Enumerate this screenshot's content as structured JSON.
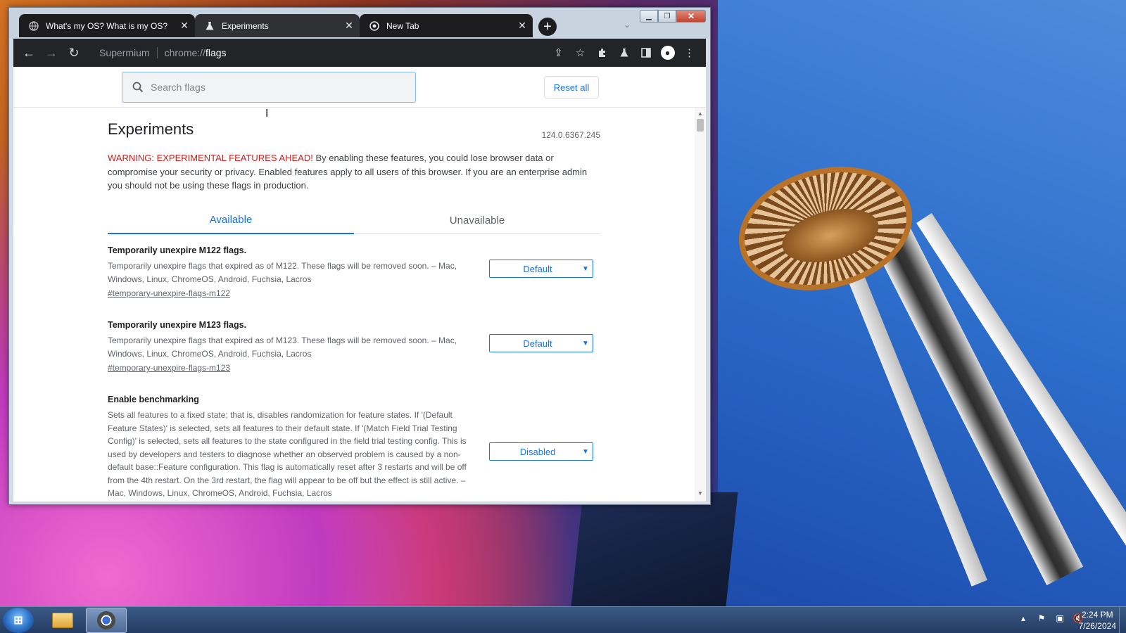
{
  "browser": {
    "tabs": [
      {
        "title": "What's my OS? What is my OS?",
        "icon": "globe-icon"
      },
      {
        "title": "Experiments",
        "icon": "flask-icon"
      },
      {
        "title": "New Tab",
        "icon": "chromium-icon"
      }
    ],
    "omnibox": {
      "host": "Supermium",
      "url_prefix": "chrome://",
      "url_path": "flags"
    }
  },
  "page": {
    "search_placeholder": "Search flags",
    "reset_label": "Reset all",
    "title": "Experiments",
    "version": "124.0.6367.245",
    "warning_lead": "WARNING: EXPERIMENTAL FEATURES AHEAD!",
    "warning_body": " By enabling these features, you could lose browser data or compromise your security or privacy. Enabled features apply to all users of this browser. If you are an enterprise admin you should not be using these flags in production.",
    "tabs": [
      {
        "label": "Available",
        "active": true
      },
      {
        "label": "Unavailable",
        "active": false
      }
    ],
    "flags": [
      {
        "name": "Temporarily unexpire M122 flags.",
        "description": "Temporarily unexpire flags that expired as of M122. These flags will be removed soon. – Mac, Windows, Linux, ChromeOS, Android, Fuchsia, Lacros",
        "link": "#temporary-unexpire-flags-m122",
        "value": "Default"
      },
      {
        "name": "Temporarily unexpire M123 flags.",
        "description": "Temporarily unexpire flags that expired as of M123. These flags will be removed soon. – Mac, Windows, Linux, ChromeOS, Android, Fuchsia, Lacros",
        "link": "#temporary-unexpire-flags-m123",
        "value": "Default"
      },
      {
        "name": "Enable benchmarking",
        "description": "Sets all features to a fixed state; that is, disables randomization for feature states. If '(Default Feature States)' is selected, sets all features to their default state. If '(Match Field Trial Testing Config)' is selected, sets all features to the state configured in the field trial testing config. This is used by developers and testers to diagnose whether an observed problem is caused by a non-default base::Feature configuration. This flag is automatically reset after 3 restarts and will be off from the 4th restart. On the 3rd restart, the flag will appear to be off but the effect is still active. – Mac, Windows, Linux, ChromeOS, Android, Fuchsia, Lacros",
        "value": "Disabled"
      }
    ]
  },
  "taskbar": {
    "clock_time": "2:24 PM",
    "clock_date": "7/26/2024"
  },
  "colors": {
    "accent": "#1a73e8",
    "warning": "#c5221f",
    "toolbar": "#232427"
  }
}
